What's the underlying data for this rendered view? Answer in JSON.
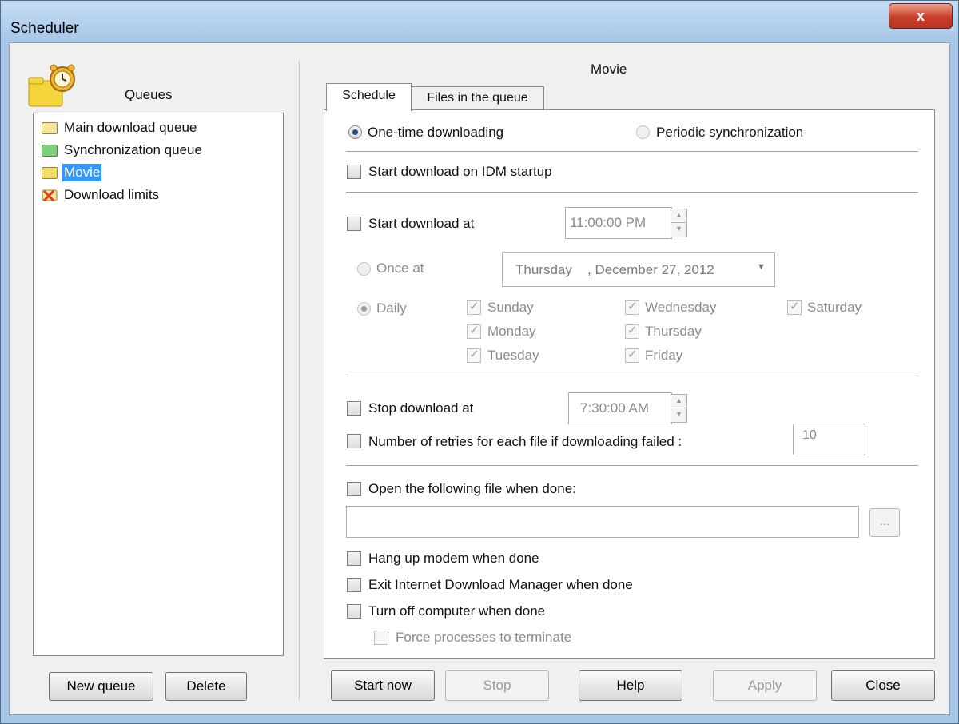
{
  "window": {
    "title": "Scheduler",
    "close_glyph": "x"
  },
  "queues": {
    "label": "Queues",
    "items": [
      {
        "label": "Main download queue",
        "icon": "folder-icon",
        "color": "#f6e59a"
      },
      {
        "label": "Synchronization queue",
        "icon": "sync-folder-icon",
        "color": "#7fd07a"
      },
      {
        "label": "Movie",
        "icon": "folder-icon",
        "color": "#f3de6a",
        "selected": true
      },
      {
        "label": "Download limits",
        "icon": "limits-icon",
        "color": "#e04020"
      }
    ],
    "new_queue_button": "New queue",
    "delete_button": "Delete"
  },
  "main": {
    "queue_title": "Movie",
    "tabs": [
      "Schedule",
      "Files in the queue"
    ],
    "schedule": {
      "one_time_label": "One-time downloading",
      "periodic_label": "Periodic synchronization",
      "start_on_startup_label": "Start download on IDM startup",
      "start_download_at_label": "Start download at",
      "start_time": "11:00:00 PM",
      "once_at_label": "Once at",
      "once_date_day": "Thursday",
      "once_date_rest": ", December 27, 2012",
      "daily_label": "Daily",
      "days": {
        "sunday": "Sunday",
        "monday": "Monday",
        "tuesday": "Tuesday",
        "wednesday": "Wednesday",
        "thursday": "Thursday",
        "friday": "Friday",
        "saturday": "Saturday"
      },
      "stop_download_at_label": "Stop download at",
      "stop_time": "7:30:00 AM",
      "retries_label": "Number of retries for each file if downloading failed :",
      "retries_value": "10",
      "open_file_label": "Open the following file when done:",
      "open_file_value": "",
      "browse_label": "...",
      "hang_up_label": "Hang up modem when done",
      "exit_idm_label": "Exit Internet Download Manager when done",
      "turn_off_label": "Turn off computer when done",
      "force_label": "Force processes to terminate"
    }
  },
  "footer": {
    "start_now": "Start now",
    "stop": "Stop",
    "help": "Help",
    "apply": "Apply",
    "close": "Close"
  }
}
